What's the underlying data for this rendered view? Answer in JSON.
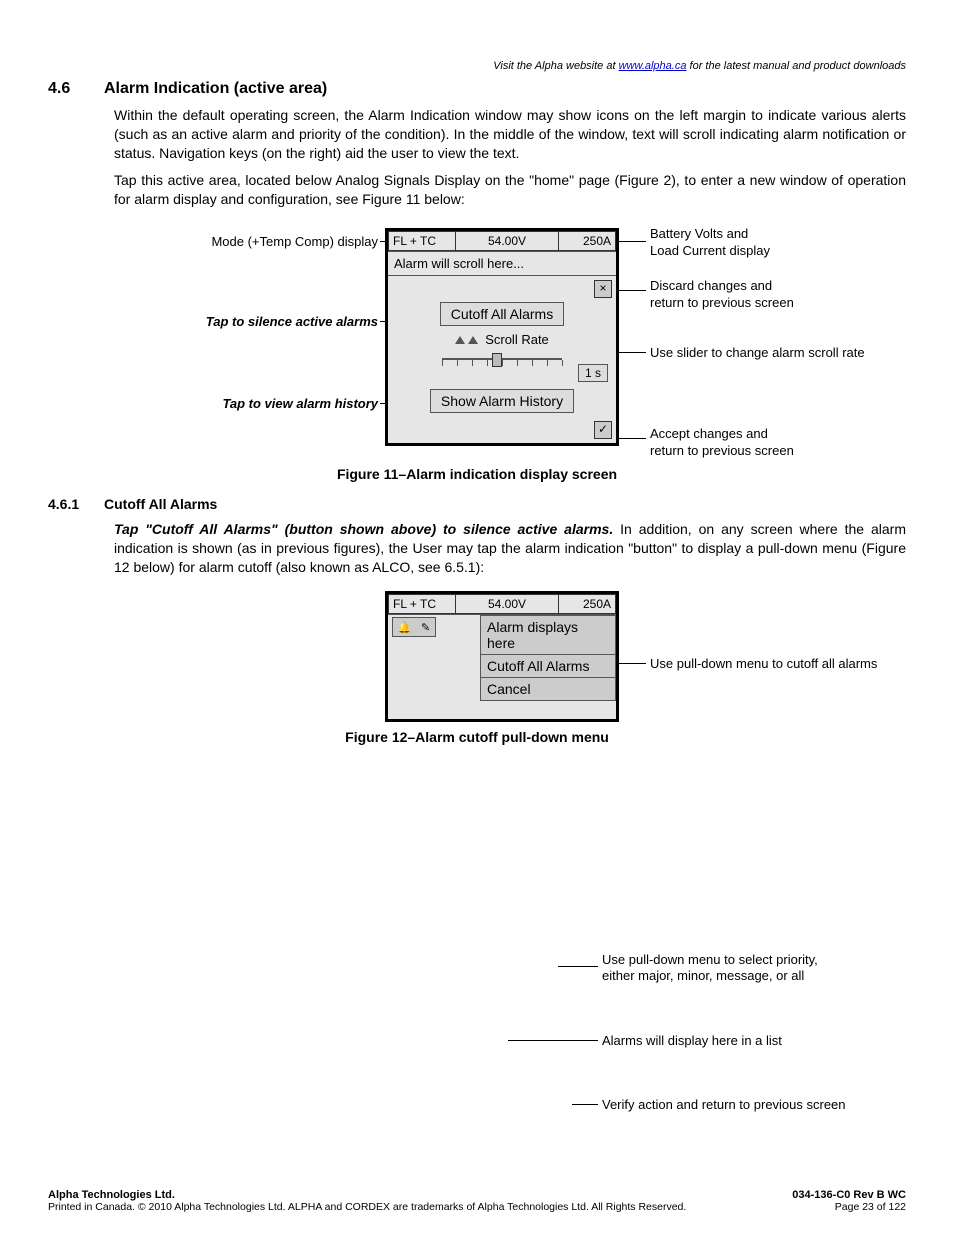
{
  "topNote": {
    "pre": "Visit the Alpha website at ",
    "link": "www.alpha.ca",
    "post": " for the latest manual and product downloads"
  },
  "section": {
    "num": "4.6",
    "title": "Alarm Indication (active area)"
  },
  "para1": "Within the default operating screen, the Alarm Indication window may show icons on the left margin to indicate various alerts (such as an active alarm and priority of the condition). In the middle of the window, text will scroll indicating alarm notification or status. Navigation keys (on the right) aid the user to view the text.",
  "para2": "Tap this active area, located below Analog Signals Display on the \"home\" page (Figure 2), to enter a new window of operation for alarm display and configuration, see Figure 11 below:",
  "fig11": {
    "mode": "FL + TC",
    "volts": "54.00V",
    "amps": "250A",
    "scrollMsg": "Alarm will scroll here...",
    "cutoffBtn": "Cutoff All Alarms",
    "scrollRateLabel": "Scroll Rate",
    "scrollRateVal": "1 s",
    "historyBtn": "Show Alarm History",
    "callouts": {
      "modeDisp": "Mode (+Temp Comp) display",
      "silence": "Tap to silence active alarms",
      "history": "Tap to view alarm history",
      "battery": "Battery Volts and\nLoad Current display",
      "discard": "Discard changes and\nreturn to previous screen",
      "slider": "Use slider to change alarm scroll rate",
      "accept": "Accept changes and\nreturn to previous screen"
    },
    "caption": "Figure 11–Alarm indication display screen"
  },
  "sub": {
    "num": "4.6.1",
    "title": "Cutoff All Alarms"
  },
  "leadIn": "Tap \"Cutoff All Alarms\" (button shown above) to silence active alarms.",
  "para3": " In addition, on any screen where the alarm indication is shown (as in previous figures), the User may tap the alarm indication \"button\" to display a pull-down menu (Figure 12 below) for alarm cutoff (also known as ALCO, see 6.5.1):",
  "fig12": {
    "mode": "FL + TC",
    "volts": "54.00V",
    "amps": "250A",
    "menu": [
      "Alarm displays here",
      "Cutoff All Alarms",
      "Cancel"
    ],
    "callout": "Use pull-down menu to cutoff all alarms",
    "caption": "Figure 12–Alarm cutoff pull-down menu"
  },
  "lowerAnn": {
    "priority": "Use pull-down menu to select priority,\neither major, minor, message, or all",
    "list": "Alarms will display here in a list",
    "verify": "Verify action and return to previous screen"
  },
  "footer": {
    "company": "Alpha Technologies Ltd.",
    "doc": "034-136-C0  Rev B  WC",
    "legal": "Printed in Canada.  © 2010 Alpha Technologies Ltd.  ALPHA and CORDEX are trademarks of Alpha Technologies Ltd.  All Rights Reserved.",
    "page": "Page 23 of 122"
  }
}
